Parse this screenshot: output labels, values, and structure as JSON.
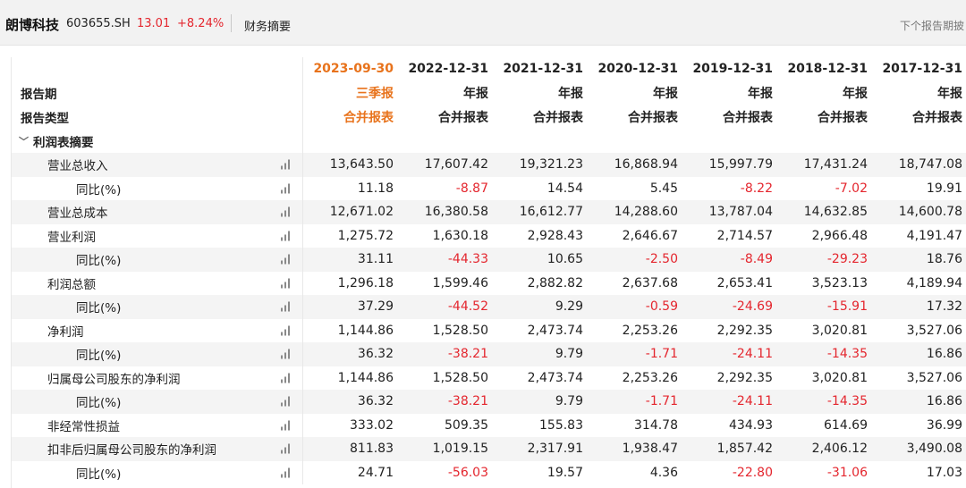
{
  "header": {
    "company": "朗博科技",
    "code": "603655.SH",
    "price": "13.01",
    "change": "+8.24%",
    "tab": "财务摘要",
    "next_report": "下个报告期披"
  },
  "table": {
    "periods": [
      "2023-09-30",
      "2022-12-31",
      "2021-12-31",
      "2020-12-31",
      "2019-12-31",
      "2018-12-31",
      "2017-12-31"
    ],
    "period_label": "报告期",
    "period_types": [
      "三季报",
      "年报",
      "年报",
      "年报",
      "年报",
      "年报",
      "年报"
    ],
    "type_label": "报告类型",
    "report_types": [
      "合并报表",
      "合并报表",
      "合并报表",
      "合并报表",
      "合并报表",
      "合并报表",
      "合并报表"
    ],
    "section_title": "利润表摘要",
    "section_icon": "chevron-down-icon",
    "row_icon": "bar-chart-icon",
    "colors": {
      "negative": "#e4262e",
      "highlight": "#e8731c",
      "row_shade": "#f4f4f4"
    },
    "rows": [
      {
        "label": "营业总收入",
        "indent": 1,
        "values": [
          "13,643.50",
          "17,607.42",
          "19,321.23",
          "16,868.94",
          "15,997.79",
          "17,431.24",
          "18,747.08"
        ]
      },
      {
        "label": "同比(%)",
        "indent": 2,
        "values": [
          "11.18",
          "-8.87",
          "14.54",
          "5.45",
          "-8.22",
          "-7.02",
          "19.91"
        ]
      },
      {
        "label": "营业总成本",
        "indent": 1,
        "values": [
          "12,671.02",
          "16,380.58",
          "16,612.77",
          "14,288.60",
          "13,787.04",
          "14,632.85",
          "14,600.78"
        ]
      },
      {
        "label": "营业利润",
        "indent": 1,
        "values": [
          "1,275.72",
          "1,630.18",
          "2,928.43",
          "2,646.67",
          "2,714.57",
          "2,966.48",
          "4,191.47"
        ]
      },
      {
        "label": "同比(%)",
        "indent": 2,
        "values": [
          "31.11",
          "-44.33",
          "10.65",
          "-2.50",
          "-8.49",
          "-29.23",
          "18.76"
        ]
      },
      {
        "label": "利润总额",
        "indent": 1,
        "values": [
          "1,296.18",
          "1,599.46",
          "2,882.82",
          "2,637.68",
          "2,653.41",
          "3,523.13",
          "4,189.94"
        ]
      },
      {
        "label": "同比(%)",
        "indent": 2,
        "values": [
          "37.29",
          "-44.52",
          "9.29",
          "-0.59",
          "-24.69",
          "-15.91",
          "17.32"
        ]
      },
      {
        "label": "净利润",
        "indent": 1,
        "values": [
          "1,144.86",
          "1,528.50",
          "2,473.74",
          "2,253.26",
          "2,292.35",
          "3,020.81",
          "3,527.06"
        ]
      },
      {
        "label": "同比(%)",
        "indent": 2,
        "values": [
          "36.32",
          "-38.21",
          "9.79",
          "-1.71",
          "-24.11",
          "-14.35",
          "16.86"
        ]
      },
      {
        "label": "归属母公司股东的净利润",
        "indent": 1,
        "values": [
          "1,144.86",
          "1,528.50",
          "2,473.74",
          "2,253.26",
          "2,292.35",
          "3,020.81",
          "3,527.06"
        ]
      },
      {
        "label": "同比(%)",
        "indent": 2,
        "values": [
          "36.32",
          "-38.21",
          "9.79",
          "-1.71",
          "-24.11",
          "-14.35",
          "16.86"
        ]
      },
      {
        "label": "非经常性损益",
        "indent": 1,
        "values": [
          "333.02",
          "509.35",
          "155.83",
          "314.78",
          "434.93",
          "614.69",
          "36.99"
        ]
      },
      {
        "label": "扣非后归属母公司股东的净利润",
        "indent": 1,
        "values": [
          "811.83",
          "1,019.15",
          "2,317.91",
          "1,938.47",
          "1,857.42",
          "2,406.12",
          "3,490.08"
        ]
      },
      {
        "label": "同比(%)",
        "indent": 2,
        "values": [
          "24.71",
          "-56.03",
          "19.57",
          "4.36",
          "-22.80",
          "-31.06",
          "17.03"
        ]
      }
    ]
  }
}
